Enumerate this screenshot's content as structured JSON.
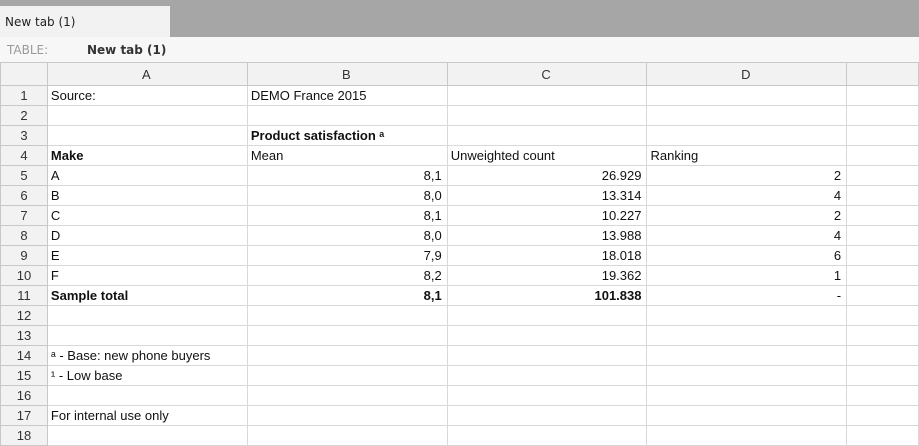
{
  "tab": {
    "label": "New tab (1)"
  },
  "info": {
    "table_label": "TABLE:",
    "table_name": "New tab (1)"
  },
  "columns": [
    "A",
    "B",
    "C",
    "D"
  ],
  "rows": [
    {
      "n": "1",
      "a": "Source:",
      "b": "DEMO France 2015",
      "c": "",
      "d": ""
    },
    {
      "n": "2",
      "a": "",
      "b": "",
      "c": "",
      "d": ""
    },
    {
      "n": "3",
      "a": "",
      "b": "Product satisfaction ᵃ",
      "c": "",
      "d": ""
    },
    {
      "n": "4",
      "a": "Make",
      "b": "Mean",
      "c": "Unweighted count",
      "d": "Ranking"
    },
    {
      "n": "5",
      "a": "A",
      "b": "8,1",
      "c": "26.929",
      "d": "2"
    },
    {
      "n": "6",
      "a": "B",
      "b": "8,0",
      "c": "13.314",
      "d": "4"
    },
    {
      "n": "7",
      "a": "C",
      "b": "8,1",
      "c": "10.227",
      "d": "2"
    },
    {
      "n": "8",
      "a": "D",
      "b": "8,0",
      "c": "13.988",
      "d": "4"
    },
    {
      "n": "9",
      "a": "E",
      "b": "7,9",
      "c": "18.018",
      "d": "6"
    },
    {
      "n": "10",
      "a": "F",
      "b": "8,2",
      "c": "19.362",
      "d": "1"
    },
    {
      "n": "11",
      "a": "Sample total",
      "b": "8,1",
      "c": "101.838",
      "d": "-"
    },
    {
      "n": "12",
      "a": "",
      "b": "",
      "c": "",
      "d": ""
    },
    {
      "n": "13",
      "a": "",
      "b": "",
      "c": "",
      "d": ""
    },
    {
      "n": "14",
      "a": "ᵃ - Base: new phone buyers",
      "b": "",
      "c": "",
      "d": ""
    },
    {
      "n": "15",
      "a": "¹ - Low base",
      "b": "",
      "c": "",
      "d": ""
    },
    {
      "n": "16",
      "a": "",
      "b": "",
      "c": "",
      "d": ""
    },
    {
      "n": "17",
      "a": "For internal use only",
      "b": "",
      "c": "",
      "d": ""
    },
    {
      "n": "18",
      "a": "",
      "b": "",
      "c": "",
      "d": ""
    }
  ]
}
